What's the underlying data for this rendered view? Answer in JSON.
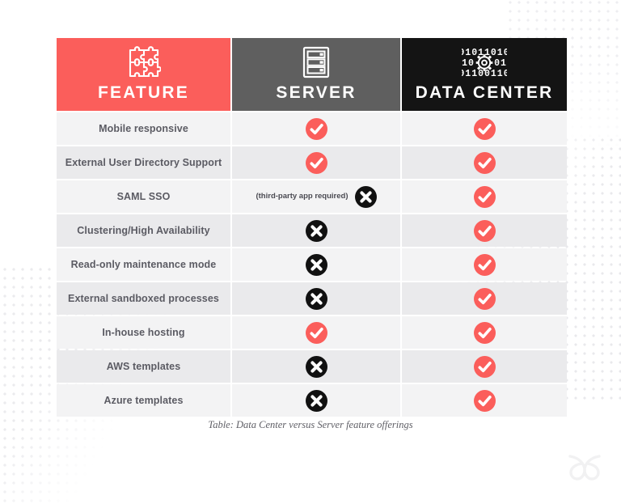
{
  "colors": {
    "accent_red": "#fb5e5b",
    "server_header_gray": "#5f5f5f",
    "datacenter_header_black": "#141414",
    "row_odd": "#f3f3f4",
    "row_even": "#eaeaec",
    "label_text": "#5b5b63",
    "page_background": "#ffffff"
  },
  "table": {
    "columns": [
      {
        "id": "feature",
        "label": "FEATURE",
        "icon": "puzzle-icon"
      },
      {
        "id": "server",
        "label": "SERVER",
        "icon": "server-rack-icon"
      },
      {
        "id": "data_center",
        "label": "DATA CENTER",
        "icon": "binary-gear-icon"
      }
    ],
    "rows": [
      {
        "feature": "Mobile responsive",
        "server": {
          "mark": "check",
          "note": ""
        },
        "data_center": {
          "mark": "check",
          "note": ""
        }
      },
      {
        "feature": "External User Directory Support",
        "server": {
          "mark": "check",
          "note": ""
        },
        "data_center": {
          "mark": "check",
          "note": ""
        }
      },
      {
        "feature": "SAML SSO",
        "server": {
          "mark": "cross",
          "note": "(third-party\napp required)"
        },
        "data_center": {
          "mark": "check",
          "note": ""
        }
      },
      {
        "feature": "Clustering/High Availability",
        "server": {
          "mark": "cross",
          "note": ""
        },
        "data_center": {
          "mark": "check",
          "note": ""
        }
      },
      {
        "feature": "Read-only maintenance mode",
        "server": {
          "mark": "cross",
          "note": ""
        },
        "data_center": {
          "mark": "check",
          "note": ""
        }
      },
      {
        "feature": "External sandboxed processes",
        "server": {
          "mark": "cross",
          "note": ""
        },
        "data_center": {
          "mark": "check",
          "note": ""
        }
      },
      {
        "feature": "In-house hosting",
        "server": {
          "mark": "check",
          "note": ""
        },
        "data_center": {
          "mark": "check",
          "note": ""
        }
      },
      {
        "feature": "AWS templates",
        "server": {
          "mark": "cross",
          "note": ""
        },
        "data_center": {
          "mark": "check",
          "note": ""
        }
      },
      {
        "feature": "Azure templates",
        "server": {
          "mark": "cross",
          "note": ""
        },
        "data_center": {
          "mark": "check",
          "note": ""
        }
      }
    ]
  },
  "caption": "Table: Data Center versus Server feature offerings",
  "brand": {
    "icon": "butterfly-logo-icon"
  },
  "icons": {
    "check": "check-circle-icon",
    "cross": "cross-circle-icon"
  }
}
